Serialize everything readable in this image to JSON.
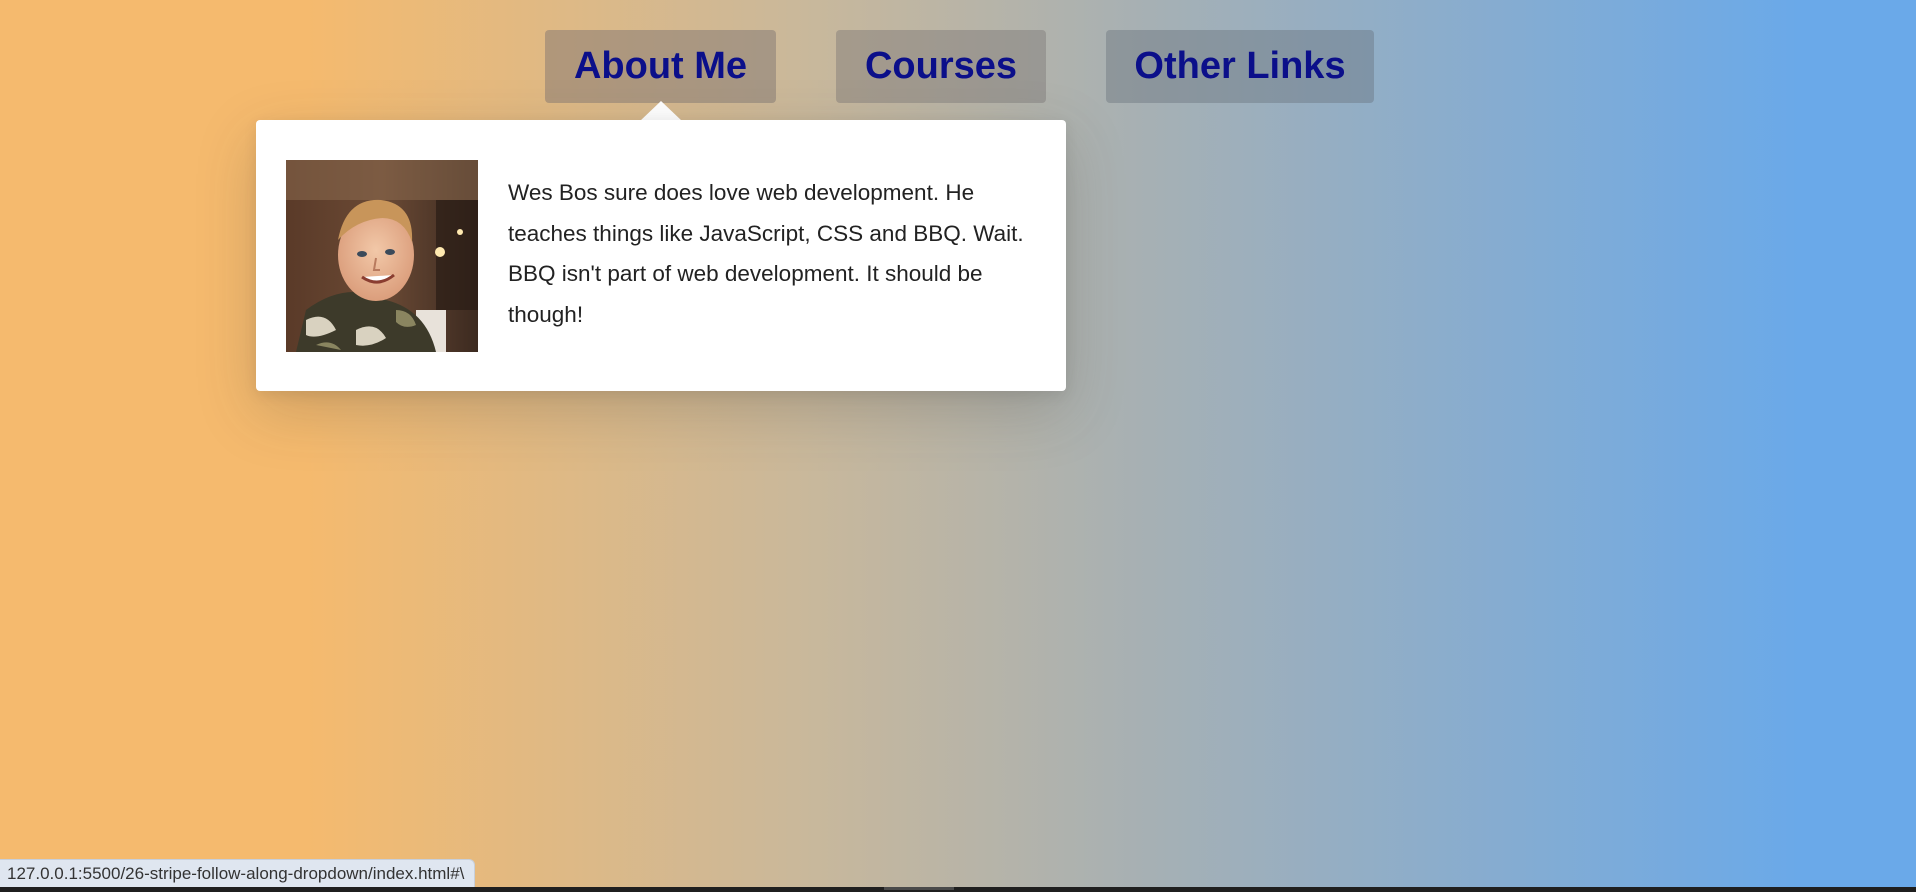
{
  "nav": {
    "items": [
      {
        "label": "About Me"
      },
      {
        "label": "Courses"
      },
      {
        "label": "Other Links"
      }
    ],
    "active_item": "About Me"
  },
  "dropdown": {
    "bio": "Wes Bos sure does love web development. He teaches things like JavaScript, CSS and BBQ. Wait. BBQ isn't part of web development. It should be though!",
    "photo_icon": "profile-photo"
  },
  "status_bar": {
    "url": "127.0.0.1:5500/26-stripe-follow-along-dropdown/index.html#\\"
  },
  "colors": {
    "background_left": "#f5ba6e",
    "background_right": "#6aa9e9",
    "nav_text": "#0b0f8a",
    "dropdown_bg": "#ffffff"
  }
}
